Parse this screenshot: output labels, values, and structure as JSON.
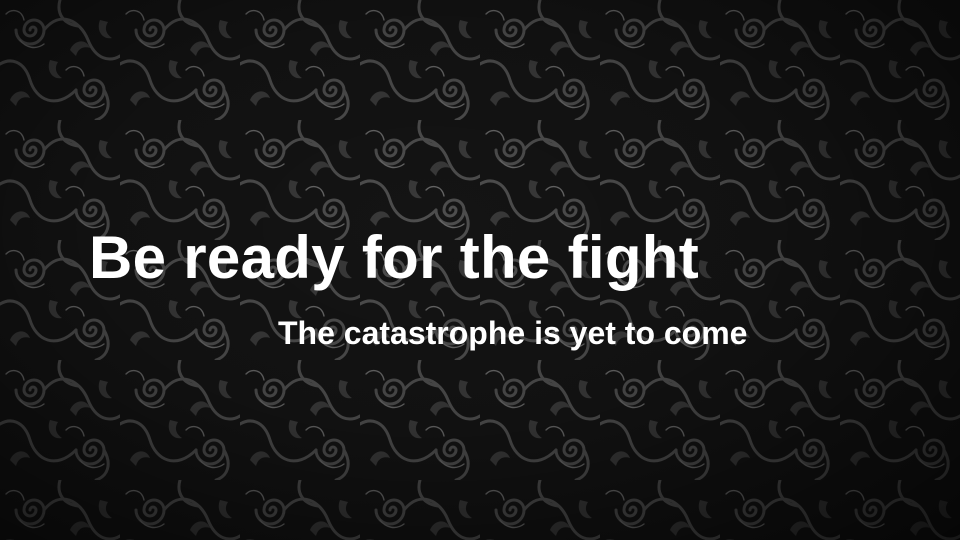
{
  "slide": {
    "title": "Be ready for the fight",
    "subtitle": "The catastrophe is yet to come",
    "background": "dark-damask-swirl-pattern",
    "colors": {
      "background": "#111111",
      "pattern": "#5a5a5a",
      "text": "#ffffff"
    }
  }
}
